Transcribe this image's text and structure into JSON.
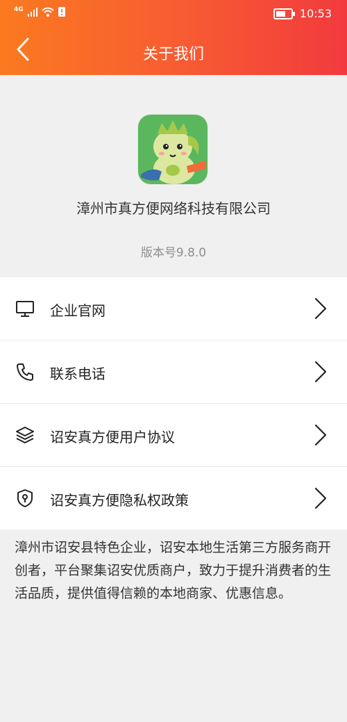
{
  "status_bar": {
    "network": "4G",
    "time": "10:53"
  },
  "nav": {
    "title": "关于我们"
  },
  "about": {
    "company_name": "漳州市真方便网络科技有限公司",
    "version": "版本号9.8.0"
  },
  "menu": {
    "items": [
      {
        "label": "企业官网",
        "icon": "monitor-icon"
      },
      {
        "label": "联系电话",
        "icon": "phone-icon"
      },
      {
        "label": "诏安真方便用户协议",
        "icon": "layers-icon"
      },
      {
        "label": "诏安真方便隐私权政策",
        "icon": "shield-icon"
      }
    ]
  },
  "description": "漳州市诏安县特色企业，诏安本地生活第三方服务商开创者，平台聚集诏安优质商户，致力于提升消费者的生活品质，提供值得信赖的本地商家、优惠信息。",
  "colors": {
    "header_start": "#fb7a20",
    "header_end": "#f23a3e",
    "app_icon_bg": "#5bb75e"
  }
}
